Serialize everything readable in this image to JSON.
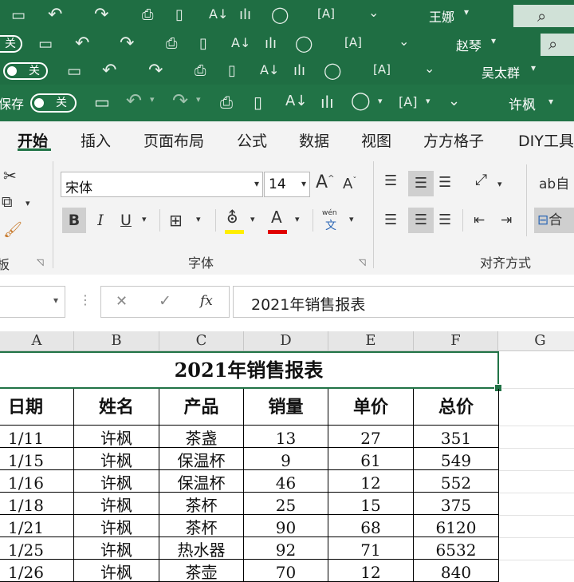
{
  "windows": [
    {
      "user": "王娜"
    },
    {
      "toggle": "关",
      "user": "赵琴"
    },
    {
      "toggle": "关",
      "user": "吴太群"
    },
    {
      "autosave_label": "保存",
      "toggle": "关",
      "user": "许枫"
    }
  ],
  "icons": {
    "save": "💾",
    "undo": "↶",
    "redo": "↷",
    "print_preview": "🖨",
    "new_doc": "🗋",
    "sort": "A↓Z",
    "chart": "📊",
    "shapes": "◯",
    "ocr": "[A]",
    "customize": "⌄",
    "search": "⌕"
  },
  "tabs": [
    "开始",
    "插入",
    "页面布局",
    "公式",
    "数据",
    "视图",
    "方方格子",
    "DIY工具"
  ],
  "ribbon": {
    "clipboard_label": "板",
    "font_name": "宋体",
    "font_size": "14",
    "grow_font": "A",
    "shrink_font": "A",
    "bold": "B",
    "italic": "I",
    "underline": "U",
    "phonetic_top": "wén",
    "phonetic_bottom": "文",
    "font_group_label": "字体",
    "wrap_label": "自",
    "merge_label": "合",
    "align_group_label": "对齐方式"
  },
  "formula_bar": {
    "cancel": "✕",
    "confirm": "✓",
    "fx": "fx",
    "content": "2021年销售报表"
  },
  "columns": [
    "A",
    "B",
    "C",
    "D",
    "E",
    "F",
    "G"
  ],
  "sheet": {
    "title": "2021年销售报表",
    "headers": [
      "日期",
      "姓名",
      "产品",
      "销量",
      "单价",
      "总价"
    ],
    "rows": [
      [
        "1/11",
        "许枫",
        "茶盏",
        "13",
        "27",
        "351"
      ],
      [
        "1/15",
        "许枫",
        "保温杯",
        "9",
        "61",
        "549"
      ],
      [
        "1/16",
        "许枫",
        "保温杯",
        "46",
        "12",
        "552"
      ],
      [
        "1/18",
        "许枫",
        "茶杯",
        "25",
        "15",
        "375"
      ],
      [
        "1/21",
        "许枫",
        "茶杯",
        "90",
        "68",
        "6120"
      ],
      [
        "1/25",
        "许枫",
        "热水器",
        "92",
        "71",
        "6532"
      ],
      [
        "1/26",
        "许枫",
        "茶壶",
        "70",
        "12",
        "840"
      ]
    ]
  }
}
